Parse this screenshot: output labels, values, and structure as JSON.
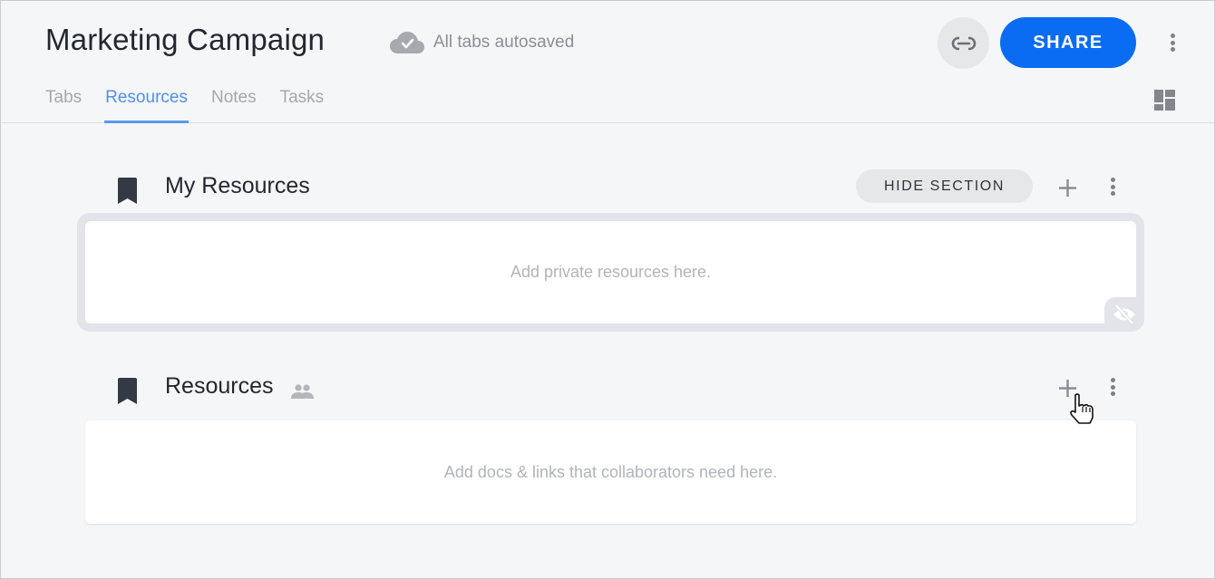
{
  "header": {
    "title": "Marketing Campaign",
    "autosave_status": "All tabs autosaved",
    "share_label": "SHARE",
    "accent_color": "#0a6cf2"
  },
  "tabs": [
    {
      "label": "Tabs",
      "active": false
    },
    {
      "label": "Resources",
      "active": true
    },
    {
      "label": "Notes",
      "active": false
    },
    {
      "label": "Tasks",
      "active": false
    }
  ],
  "sections": {
    "private": {
      "title": "My Resources",
      "hide_label": "HIDE SECTION",
      "placeholder": "Add private resources here."
    },
    "shared": {
      "title": "Resources",
      "placeholder": "Add docs & links that collaborators need here."
    }
  }
}
